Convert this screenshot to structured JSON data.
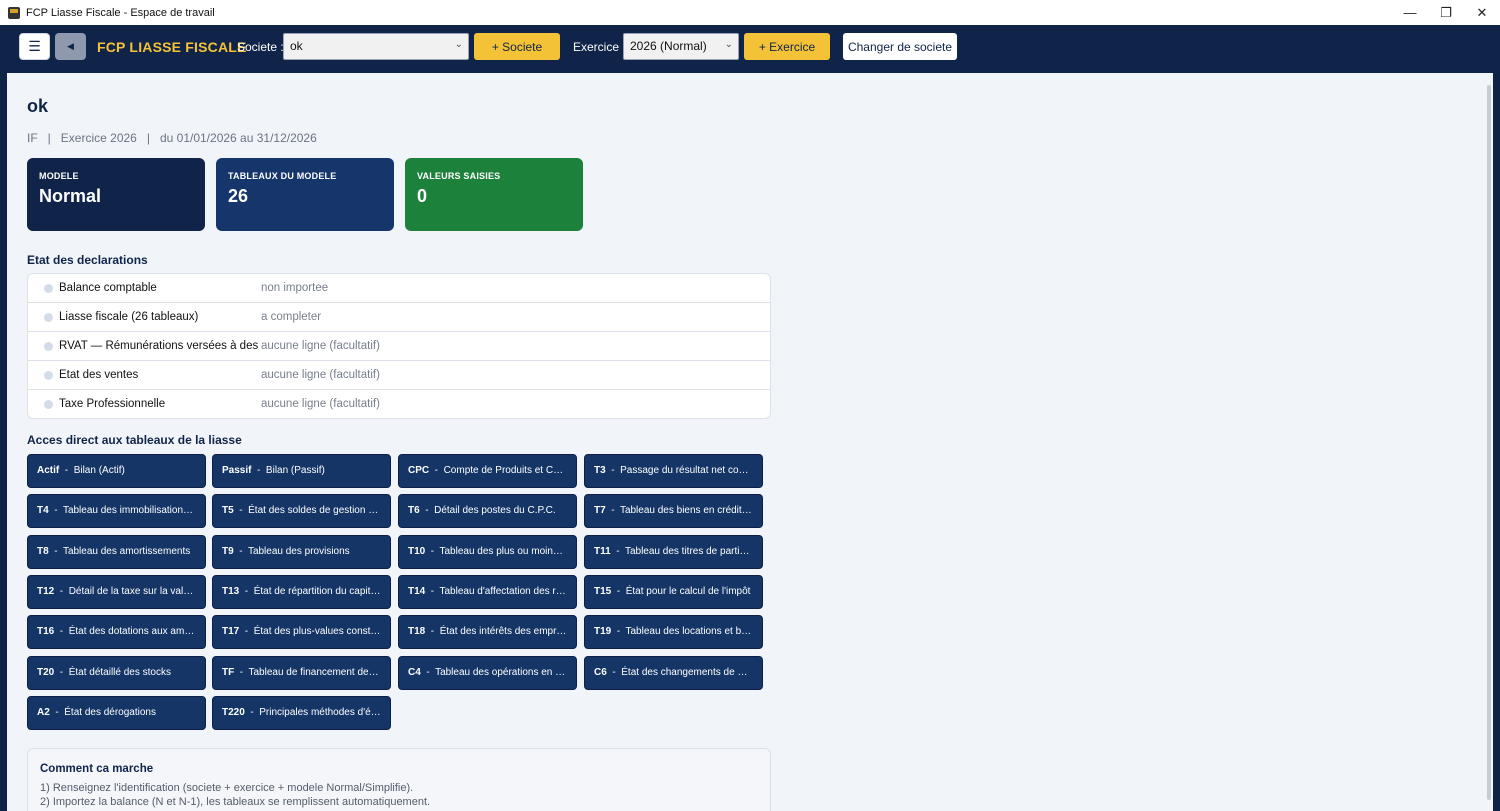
{
  "window": {
    "title": "FCP Liasse Fiscale - Espace de travail",
    "min": "—",
    "restore": "❐",
    "close": "✕"
  },
  "topbar": {
    "menu_icon": "☰",
    "back_icon": "◀",
    "brand": "FCP LIASSE FISCALE",
    "societe_label": "Societe :",
    "societe_value": "ok",
    "add_societe": "+ Societe",
    "exercice_label": "Exercice :",
    "exercice_value": "2026 (Normal)",
    "add_exercice": "+ Exercice",
    "change_societe": "Changer de societe"
  },
  "page": {
    "title": "ok",
    "sub": [
      "IF",
      "|",
      "Exercice 2026",
      "|",
      "du 01/01/2026 au 31/12/2026"
    ]
  },
  "cards": [
    {
      "label": "MODELE",
      "value": "Normal",
      "color": "#10244a"
    },
    {
      "label": "TABLEAUX DU MODELE",
      "value": "26",
      "color": "#15356b"
    },
    {
      "label": "VALEURS SAISIES",
      "value": "0",
      "color": "#1c813b"
    }
  ],
  "declarations": {
    "title": "Etat des declarations",
    "rows": [
      {
        "name": "Balance comptable",
        "status": "non importee"
      },
      {
        "name": "Liasse fiscale (26 tableaux)",
        "status": "a completer"
      },
      {
        "name": "RVAT — Rémunérations versées à des tiers",
        "status": "aucune ligne (facultatif)"
      },
      {
        "name": "État des ventes",
        "status": "aucune ligne (facultatif)"
      },
      {
        "name": "Taxe Professionnelle",
        "status": "aucune ligne (facultatif)"
      }
    ]
  },
  "tables": {
    "title": "Acces direct aux tableaux de la liasse",
    "items": [
      {
        "code": "Actif",
        "label": "Bilan (Actif)"
      },
      {
        "code": "Passif",
        "label": "Bilan (Passif)"
      },
      {
        "code": "CPC",
        "label": "Compte de Produits et Charges"
      },
      {
        "code": "T3",
        "label": "Passage du résultat net comptable"
      },
      {
        "code": "T4",
        "label": "Tableau des immobilisations autres"
      },
      {
        "code": "T5",
        "label": "État des soldes de gestion (E.S.G)"
      },
      {
        "code": "T6",
        "label": "Détail des postes du C.P.C."
      },
      {
        "code": "T7",
        "label": "Tableau des biens en crédit-bail"
      },
      {
        "code": "T8",
        "label": "Tableau des amortissements"
      },
      {
        "code": "T9",
        "label": "Tableau des provisions"
      },
      {
        "code": "T10",
        "label": "Tableau des plus ou moins-values"
      },
      {
        "code": "T11",
        "label": "Tableau des titres de participation"
      },
      {
        "code": "T12",
        "label": "Détail de la taxe sur la valeur ajoutée"
      },
      {
        "code": "T13",
        "label": "État de répartition du capital social"
      },
      {
        "code": "T14",
        "label": "Tableau d'affectation des résultats"
      },
      {
        "code": "T15",
        "label": "État pour le calcul de l'impôt"
      },
      {
        "code": "T16",
        "label": "État des dotations aux amortissements"
      },
      {
        "code": "T17",
        "label": "État des plus-values constatées"
      },
      {
        "code": "T18",
        "label": "État des intérêts des emprunts"
      },
      {
        "code": "T19",
        "label": "Tableau des locations et baux"
      },
      {
        "code": "T20",
        "label": "État détaillé des stocks"
      },
      {
        "code": "TF",
        "label": "Tableau de financement de l'exercice"
      },
      {
        "code": "C4",
        "label": "Tableau des opérations en devises"
      },
      {
        "code": "C6",
        "label": "État des changements de méthodes"
      },
      {
        "code": "A2",
        "label": "État des dérogations"
      },
      {
        "code": "T220",
        "label": "Principales méthodes d'évaluation"
      }
    ]
  },
  "help": {
    "title": "Comment ca marche",
    "lines": [
      "1) Renseignez l'identification (societe + exercice + modele Normal/Simplifie).",
      "2) Importez la balance (N et N-1), les tableaux se remplissent automatiquement."
    ]
  }
}
